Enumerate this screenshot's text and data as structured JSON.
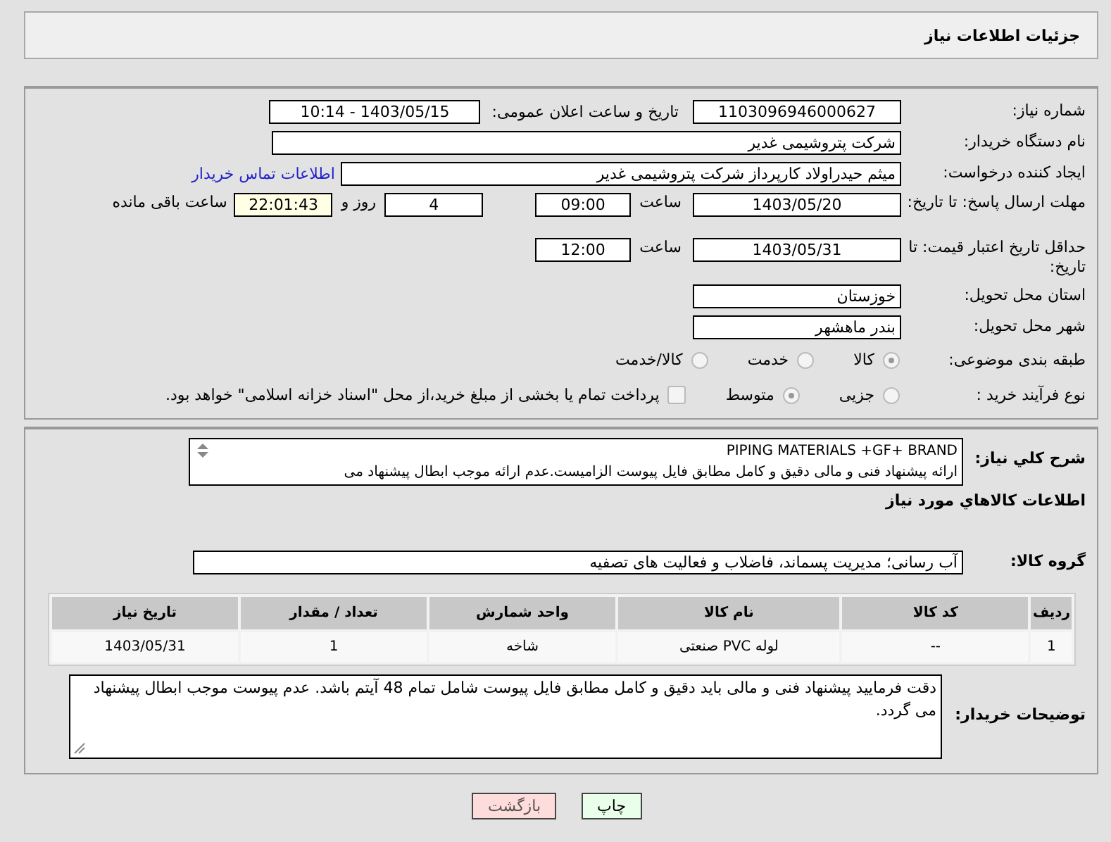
{
  "header": {
    "title": "جزئیات اطلاعات نیاز"
  },
  "details": {
    "need_number": {
      "label": "شماره نیاز:",
      "value": "1103096946000627"
    },
    "announce": {
      "label": "تاریخ و ساعت اعلان عمومی:",
      "value": "1403/05/15 - 10:14"
    },
    "buyer": {
      "label": "نام دستگاه خریدار:",
      "value": "شرکت پتروشیمی غدیر"
    },
    "requester": {
      "label": "ایجاد کننده درخواست:",
      "value": "میثم حیدراولاد کارپرداز شرکت پتروشیمی غدیر",
      "link": "اطلاعات تماس خریدار"
    },
    "reply_deadline": {
      "label": "مهلت ارسال پاسخ: تا تاریخ:",
      "date": "1403/05/20",
      "time_label": "ساعت",
      "time": "09:00",
      "days": "4",
      "days_label": "روز و",
      "remaining": "22:01:43",
      "remaining_label": "ساعت باقی مانده"
    },
    "price_validity": {
      "label": "حداقل تاریخ اعتبار قیمت: تا تاریخ:",
      "date": "1403/05/31",
      "time_label": "ساعت",
      "time": "12:00"
    },
    "province": {
      "label": "استان محل تحویل:",
      "value": "خوزستان"
    },
    "city": {
      "label": "شهر محل تحویل:",
      "value": "بندر ماهشهر"
    },
    "category": {
      "label": "طبقه بندی موضوعی:",
      "options": [
        {
          "label": "کالا",
          "selected": true
        },
        {
          "label": "خدمت",
          "selected": false
        },
        {
          "label": "کالا/خدمت",
          "selected": false
        }
      ]
    },
    "process": {
      "label": "نوع فرآیند خرید :",
      "options": [
        {
          "label": "جزیی",
          "selected": false
        },
        {
          "label": "متوسط",
          "selected": true
        }
      ],
      "payment": {
        "label": "پرداخت تمام یا بخشی از مبلغ خرید،از محل \"اسناد خزانه اسلامی\" خواهد بود.",
        "checked": false
      }
    }
  },
  "description": {
    "label": "شرح کلي نياز:",
    "lines": [
      "PIPING MATERIALS +GF+ BRAND",
      "ارائه پیشنهاد فنی و مالی دقیق و کامل مطابق فایل پیوست الزامیست.عدم ارائه موجب ابطال پیشنهاد می"
    ]
  },
  "goods": {
    "title": "اطلاعات کالاهاي مورد نياز",
    "group": {
      "label": "گروه کالا:",
      "value": "آب رسانی؛ مدیریت پسماند، فاضلاب و فعالیت های تصفیه"
    },
    "table": {
      "columns": [
        "ردیف",
        "کد کالا",
        "نام کالا",
        "واحد شمارش",
        "تعداد / مقدار",
        "تاریخ نیاز"
      ],
      "rows": [
        [
          "1",
          "--",
          "لوله PVC صنعتی",
          "شاخه",
          "1",
          "1403/05/31"
        ]
      ]
    },
    "buyer_notes": {
      "label": "توضیحات خریدار:",
      "value": "دقت فرمایید پیشنهاد فنی و مالی باید دقیق و کامل مطابق فایل پیوست شامل تمام 48 آیتم باشد. عدم پیوست موجب ابطال پیشنهاد می گردد."
    }
  },
  "buttons": [
    {
      "label": "چاپ",
      "kind": "print"
    },
    {
      "label": "بازگشت",
      "kind": "back"
    }
  ]
}
